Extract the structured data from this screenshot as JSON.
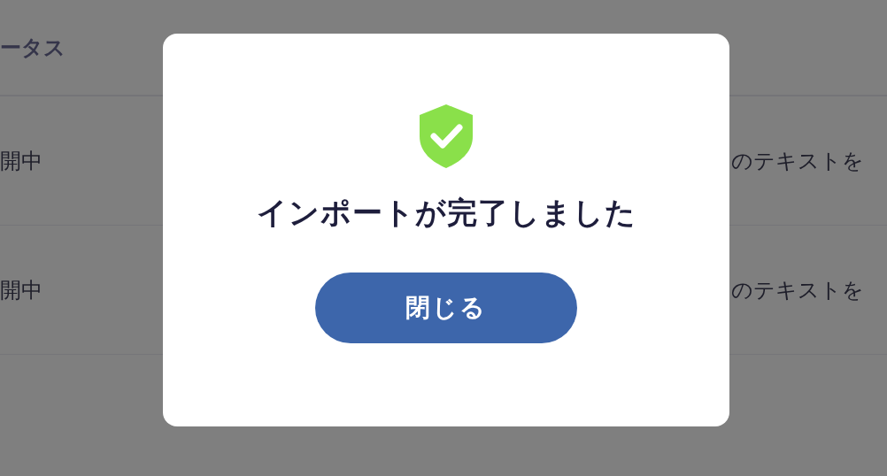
{
  "table": {
    "columns": [
      {
        "label": "ータス"
      }
    ],
    "rows": [
      {
        "cells": [
          "開中",
          "のテキストを"
        ]
      },
      {
        "cells": [
          "開中",
          "のテキストを"
        ]
      }
    ]
  },
  "dialog": {
    "title": "インポートが完了しました",
    "button": "閉じる"
  }
}
